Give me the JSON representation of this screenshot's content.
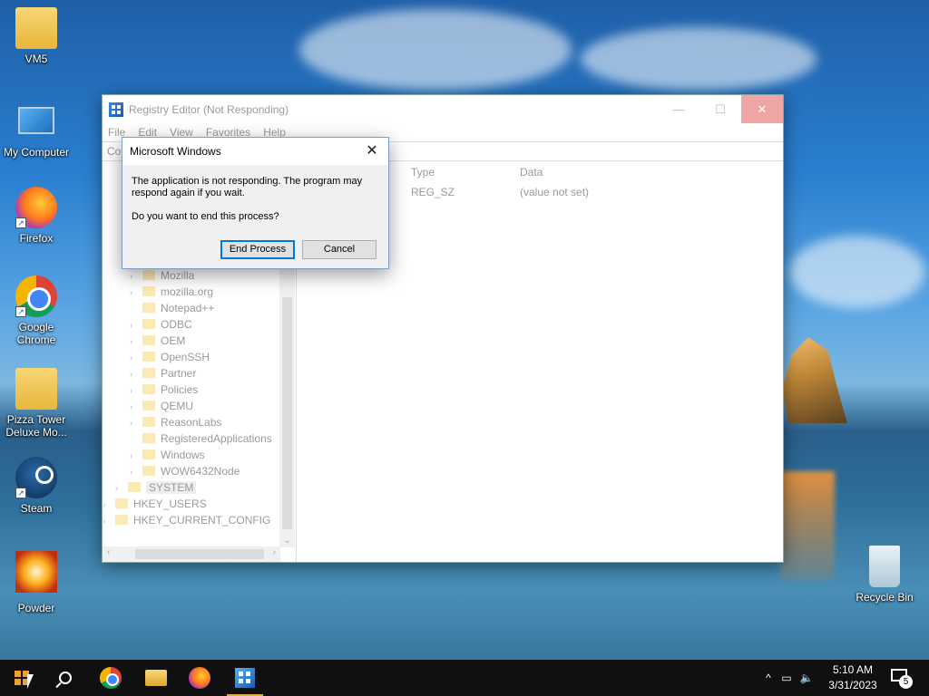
{
  "desktop": {
    "icons": [
      {
        "label": "VM5",
        "icon": "user-folder-icon"
      },
      {
        "label": "My Computer",
        "icon": "computer-icon"
      },
      {
        "label": "Firefox",
        "icon": "firefox-icon"
      },
      {
        "label": "Google Chrome",
        "icon": "chrome-icon"
      },
      {
        "label": "Pizza Tower Deluxe Mo...",
        "icon": "folder-icon"
      },
      {
        "label": "Steam",
        "icon": "steam-icon"
      },
      {
        "label": "Powder",
        "icon": "powder-icon"
      },
      {
        "label": "Recycle Bin",
        "icon": "recycle-bin-icon"
      }
    ]
  },
  "registry": {
    "title": "Registry Editor (Not Responding)",
    "menu": [
      "File",
      "Edit",
      "View",
      "Favorites",
      "Help"
    ],
    "address": "Co",
    "tree": [
      {
        "label": "Mozilla",
        "level": 2
      },
      {
        "label": "mozilla.org",
        "level": 2
      },
      {
        "label": "Notepad++",
        "level": 2
      },
      {
        "label": "ODBC",
        "level": 2
      },
      {
        "label": "OEM",
        "level": 2
      },
      {
        "label": "OpenSSH",
        "level": 2
      },
      {
        "label": "Partner",
        "level": 2
      },
      {
        "label": "Policies",
        "level": 2
      },
      {
        "label": "QEMU",
        "level": 2
      },
      {
        "label": "ReasonLabs",
        "level": 2
      },
      {
        "label": "RegisteredApplications",
        "level": 2
      },
      {
        "label": "Windows",
        "level": 2
      },
      {
        "label": "WOW6432Node",
        "level": 2
      },
      {
        "label": "SYSTEM",
        "level": 1
      },
      {
        "label": "HKEY_USERS",
        "level": 0
      },
      {
        "label": "HKEY_CURRENT_CONFIG",
        "level": 0
      }
    ],
    "columns": {
      "type": "Type",
      "data": "Data"
    },
    "row": {
      "type": "REG_SZ",
      "data": "(value not set)"
    }
  },
  "dialog": {
    "title": "Microsoft Windows",
    "message1": "The application is not responding. The program may respond again if you wait.",
    "message2": "Do you want to end this process?",
    "end_label": "End Process",
    "cancel_label": "Cancel"
  },
  "taskbar": {
    "time": "5:10 AM",
    "date": "3/31/2023",
    "notification_count": "5",
    "accent": "#e0a840"
  }
}
